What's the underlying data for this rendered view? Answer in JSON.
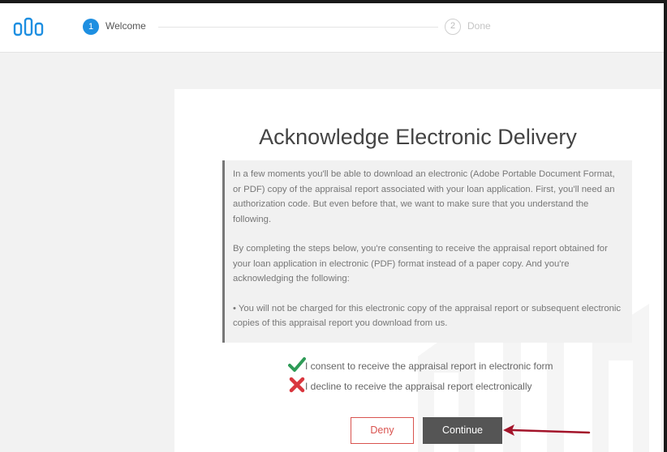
{
  "header": {
    "steps": [
      {
        "number": "1",
        "label": "Welcome"
      },
      {
        "number": "2",
        "label": "Done"
      }
    ]
  },
  "main": {
    "title": "Acknowledge Electronic Delivery",
    "notice": {
      "paragraph1": "In a few moments you'll be able to download an electronic (Adobe Portable Document Format, or PDF) copy of the appraisal report associated with your loan application. First, you'll need an authorization code. But even before that, we want to make sure that you understand the following.",
      "paragraph2": "By completing the steps below, you're consenting to receive the appraisal report obtained for your loan application in electronic (PDF) format instead of a paper copy. And you're acknowledging the following:",
      "bullet1": "•  You will not be charged for this electronic copy of the appraisal report or subsequent electronic copies of this appraisal report you download from us."
    },
    "options": {
      "consent": "I consent to receive the appraisal report in electronic form",
      "decline": "I decline to receive the appraisal report electronically"
    },
    "buttons": {
      "deny": "Deny",
      "continue": "Continue"
    }
  },
  "colors": {
    "step_active": "#1e8fe1",
    "logo": "#1e8fe1",
    "deny": "#d9534f",
    "continue_bg": "#555555",
    "annotation_arrow": "#a3142a"
  },
  "icons": [
    "logo-icon",
    "check-icon",
    "cross-icon",
    "annotation-arrow-icon"
  ]
}
